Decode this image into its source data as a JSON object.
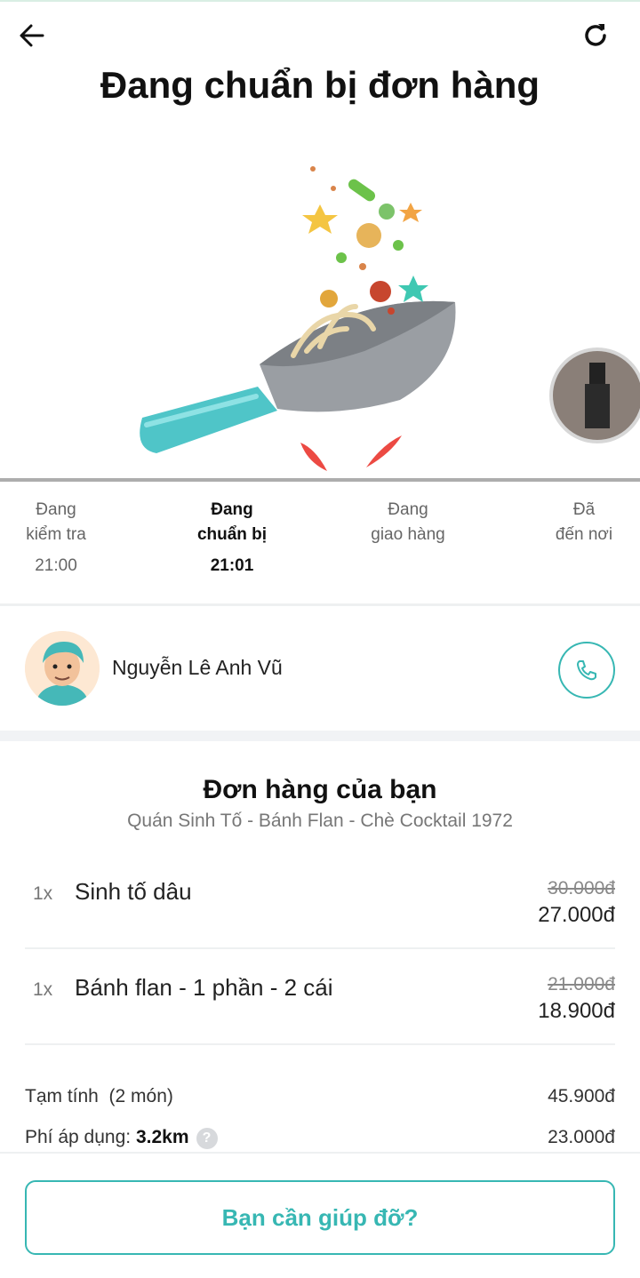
{
  "header": {
    "title": "Đang chuẩn bị đơn hàng",
    "back_icon": "arrow-left-icon",
    "refresh_icon": "refresh-icon"
  },
  "hero": {
    "illustration": "wok-cooking-illustration",
    "thumbnail": "person-photo-thumbnail"
  },
  "steps": [
    {
      "line1": "Đang",
      "line2": "kiểm tra",
      "time": "21:00",
      "active": false
    },
    {
      "line1": "Đang",
      "line2": "chuẩn bị",
      "time": "21:01",
      "active": true
    },
    {
      "line1": "Đang",
      "line2": "giao hàng",
      "time": "",
      "active": false
    },
    {
      "line1": "Đã",
      "line2": "đến nơi",
      "time": "",
      "active": false
    }
  ],
  "driver": {
    "name": "Nguyễn Lê Anh Vũ",
    "avatar_icon": "driver-avatar",
    "call_icon": "phone-icon"
  },
  "order": {
    "title": "Đơn hàng của bạn",
    "store": "Quán Sinh Tố - Bánh Flan - Chè Cocktail 1972",
    "items": [
      {
        "qty": "1x",
        "name": "Sinh tố dâu",
        "old_price": "30.000đ",
        "price": "27.000đ"
      },
      {
        "qty": "1x",
        "name": "Bánh flan - 1 phần - 2 cái",
        "old_price": "21.000đ",
        "price": "18.900đ"
      }
    ],
    "subtotal_label": "Tạm tính  (2 món)",
    "subtotal_value": "45.900đ",
    "fee_label": "Phí áp dụng:",
    "fee_distance": "3.2km",
    "fee_help": "?",
    "fee_value": "23.000đ"
  },
  "footer": {
    "help_button": "Bạn cần giúp đỡ?"
  },
  "colors": {
    "accent": "#37b7b3",
    "text": "#111111",
    "muted": "#777777"
  }
}
